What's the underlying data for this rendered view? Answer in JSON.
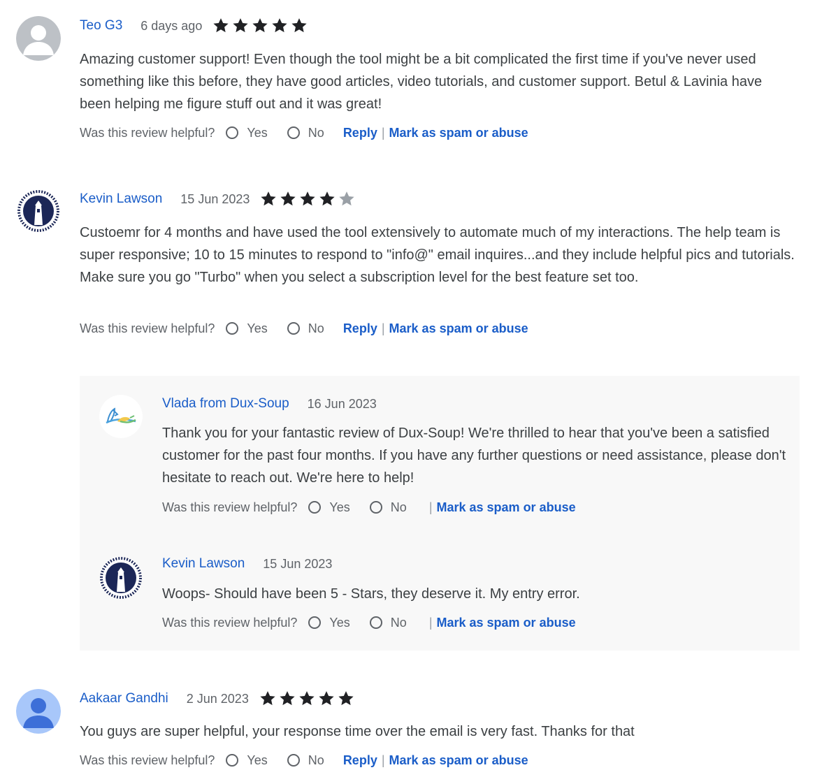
{
  "reviews": [
    {
      "author": "Teo G3",
      "date": "6 days ago",
      "rating": 5,
      "text": "Amazing customer support! Even though the tool might be a bit complicated the first time if you've never used something like this before, they have good articles, video tutorials, and customer support. Betul & Lavinia have been helping me figure stuff out and it was great!",
      "avatar_icon": "default-user-avatar"
    },
    {
      "author": "Kevin Lawson",
      "date": "15 Jun 2023",
      "rating": 4,
      "text": "Custoemr for 4 months and have used the tool extensively to automate much of my interactions.  The help team is super responsive; 10 to 15 minutes to respond to \"info@\" email inquires...and they include helpful pics and tutorials.  Make sure you go \"Turbo\" when you select a subscription level for the best feature set too.",
      "avatar_icon": "lighthouse-avatar",
      "replies": [
        {
          "author": "Vlada from Dux-Soup",
          "date": "16 Jun 2023",
          "text": "Thank you for your fantastic review of Dux-Soup! We're thrilled to hear that you've been a satisfied customer for the past four months. If you have any further questions or need assistance, please don't hesitate to reach out. We're here to help!",
          "avatar_icon": "dux-soup-logo-avatar"
        },
        {
          "author": "Kevin Lawson",
          "date": "15 Jun 2023",
          "text": "Woops- Should have been 5 - Stars, they deserve it.  My entry error.",
          "avatar_icon": "lighthouse-avatar"
        }
      ]
    },
    {
      "author": "Aakaar Gandhi",
      "date": "2 Jun 2023",
      "rating": 5,
      "text": "You guys are super helpful, your response time over the email is very fast. Thanks for that",
      "avatar_icon": "blue-user-avatar"
    }
  ],
  "labels": {
    "helpful_question": "Was this review helpful?",
    "yes": "Yes",
    "no": "No",
    "reply": "Reply",
    "separator": "|",
    "spam": "Mark as spam or abuse"
  },
  "colors": {
    "link": "#1a5dc8",
    "star_filled": "#202124",
    "star_empty": "#9aa0a6",
    "response_bg": "#f8f8f8"
  }
}
